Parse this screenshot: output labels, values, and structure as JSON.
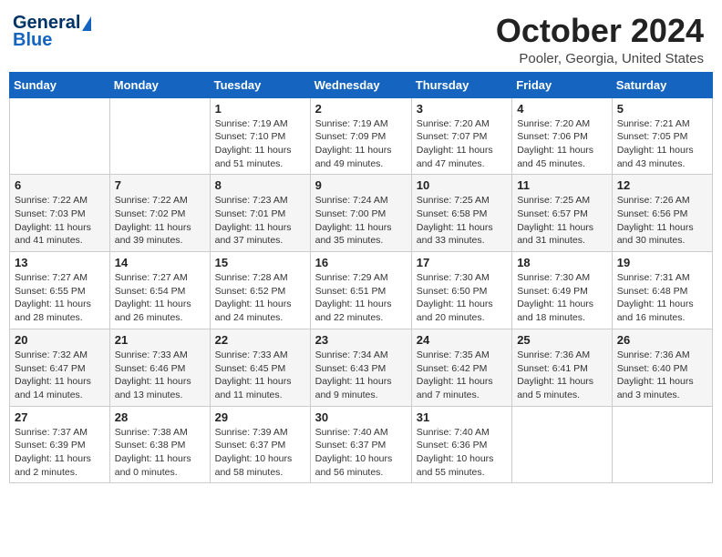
{
  "header": {
    "logo_line1": "General",
    "logo_line2": "Blue",
    "month_title": "October 2024",
    "location": "Pooler, Georgia, United States"
  },
  "days_of_week": [
    "Sunday",
    "Monday",
    "Tuesday",
    "Wednesday",
    "Thursday",
    "Friday",
    "Saturday"
  ],
  "weeks": [
    [
      {
        "day": "",
        "info": ""
      },
      {
        "day": "",
        "info": ""
      },
      {
        "day": "1",
        "info": "Sunrise: 7:19 AM\nSunset: 7:10 PM\nDaylight: 11 hours and 51 minutes."
      },
      {
        "day": "2",
        "info": "Sunrise: 7:19 AM\nSunset: 7:09 PM\nDaylight: 11 hours and 49 minutes."
      },
      {
        "day": "3",
        "info": "Sunrise: 7:20 AM\nSunset: 7:07 PM\nDaylight: 11 hours and 47 minutes."
      },
      {
        "day": "4",
        "info": "Sunrise: 7:20 AM\nSunset: 7:06 PM\nDaylight: 11 hours and 45 minutes."
      },
      {
        "day": "5",
        "info": "Sunrise: 7:21 AM\nSunset: 7:05 PM\nDaylight: 11 hours and 43 minutes."
      }
    ],
    [
      {
        "day": "6",
        "info": "Sunrise: 7:22 AM\nSunset: 7:03 PM\nDaylight: 11 hours and 41 minutes."
      },
      {
        "day": "7",
        "info": "Sunrise: 7:22 AM\nSunset: 7:02 PM\nDaylight: 11 hours and 39 minutes."
      },
      {
        "day": "8",
        "info": "Sunrise: 7:23 AM\nSunset: 7:01 PM\nDaylight: 11 hours and 37 minutes."
      },
      {
        "day": "9",
        "info": "Sunrise: 7:24 AM\nSunset: 7:00 PM\nDaylight: 11 hours and 35 minutes."
      },
      {
        "day": "10",
        "info": "Sunrise: 7:25 AM\nSunset: 6:58 PM\nDaylight: 11 hours and 33 minutes."
      },
      {
        "day": "11",
        "info": "Sunrise: 7:25 AM\nSunset: 6:57 PM\nDaylight: 11 hours and 31 minutes."
      },
      {
        "day": "12",
        "info": "Sunrise: 7:26 AM\nSunset: 6:56 PM\nDaylight: 11 hours and 30 minutes."
      }
    ],
    [
      {
        "day": "13",
        "info": "Sunrise: 7:27 AM\nSunset: 6:55 PM\nDaylight: 11 hours and 28 minutes."
      },
      {
        "day": "14",
        "info": "Sunrise: 7:27 AM\nSunset: 6:54 PM\nDaylight: 11 hours and 26 minutes."
      },
      {
        "day": "15",
        "info": "Sunrise: 7:28 AM\nSunset: 6:52 PM\nDaylight: 11 hours and 24 minutes."
      },
      {
        "day": "16",
        "info": "Sunrise: 7:29 AM\nSunset: 6:51 PM\nDaylight: 11 hours and 22 minutes."
      },
      {
        "day": "17",
        "info": "Sunrise: 7:30 AM\nSunset: 6:50 PM\nDaylight: 11 hours and 20 minutes."
      },
      {
        "day": "18",
        "info": "Sunrise: 7:30 AM\nSunset: 6:49 PM\nDaylight: 11 hours and 18 minutes."
      },
      {
        "day": "19",
        "info": "Sunrise: 7:31 AM\nSunset: 6:48 PM\nDaylight: 11 hours and 16 minutes."
      }
    ],
    [
      {
        "day": "20",
        "info": "Sunrise: 7:32 AM\nSunset: 6:47 PM\nDaylight: 11 hours and 14 minutes."
      },
      {
        "day": "21",
        "info": "Sunrise: 7:33 AM\nSunset: 6:46 PM\nDaylight: 11 hours and 13 minutes."
      },
      {
        "day": "22",
        "info": "Sunrise: 7:33 AM\nSunset: 6:45 PM\nDaylight: 11 hours and 11 minutes."
      },
      {
        "day": "23",
        "info": "Sunrise: 7:34 AM\nSunset: 6:43 PM\nDaylight: 11 hours and 9 minutes."
      },
      {
        "day": "24",
        "info": "Sunrise: 7:35 AM\nSunset: 6:42 PM\nDaylight: 11 hours and 7 minutes."
      },
      {
        "day": "25",
        "info": "Sunrise: 7:36 AM\nSunset: 6:41 PM\nDaylight: 11 hours and 5 minutes."
      },
      {
        "day": "26",
        "info": "Sunrise: 7:36 AM\nSunset: 6:40 PM\nDaylight: 11 hours and 3 minutes."
      }
    ],
    [
      {
        "day": "27",
        "info": "Sunrise: 7:37 AM\nSunset: 6:39 PM\nDaylight: 11 hours and 2 minutes."
      },
      {
        "day": "28",
        "info": "Sunrise: 7:38 AM\nSunset: 6:38 PM\nDaylight: 11 hours and 0 minutes."
      },
      {
        "day": "29",
        "info": "Sunrise: 7:39 AM\nSunset: 6:37 PM\nDaylight: 10 hours and 58 minutes."
      },
      {
        "day": "30",
        "info": "Sunrise: 7:40 AM\nSunset: 6:37 PM\nDaylight: 10 hours and 56 minutes."
      },
      {
        "day": "31",
        "info": "Sunrise: 7:40 AM\nSunset: 6:36 PM\nDaylight: 10 hours and 55 minutes."
      },
      {
        "day": "",
        "info": ""
      },
      {
        "day": "",
        "info": ""
      }
    ]
  ]
}
